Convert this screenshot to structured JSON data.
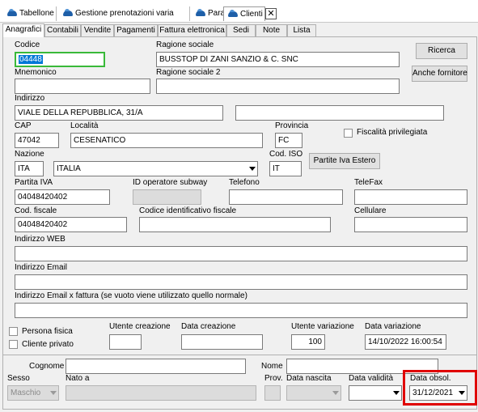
{
  "document_tabs": [
    {
      "label": "Tabellone",
      "icon": "table-icon"
    },
    {
      "label": "Gestione prenotazioni varia",
      "icon": "car-icon"
    },
    {
      "label": "Parametri",
      "icon": "car-icon"
    },
    {
      "label": "Clienti",
      "icon": "car-icon"
    }
  ],
  "close_label": "✕",
  "page_tabs": [
    "Anagrafici",
    "Contabili",
    "Vendite",
    "Pagamenti",
    "Fattura elettronica",
    "Sedi",
    "Note",
    "Lista"
  ],
  "form": {
    "codice_label": "Codice",
    "codice_value": "04448",
    "ragione_sociale_label": "Ragione sociale",
    "ragione_sociale_value": "BUSSTOP DI ZANI SANZIO & C. SNC",
    "ricerca_button": "Ricerca",
    "mnemonico_label": "Mnemonico",
    "mnemonico_value": "",
    "ragione_sociale2_label": "Ragione sociale 2",
    "ragione_sociale2_value": "",
    "anche_fornitore_button": "Anche fornitore",
    "indirizzo_label": "Indirizzo",
    "indirizzo_value": "VIALE DELLA REPUBBLICA, 31/A",
    "indirizzo2_value": "",
    "cap_label": "CAP",
    "cap_value": "47042",
    "localita_label": "Località",
    "localita_value": "CESENATICO",
    "provincia_label": "Provincia",
    "provincia_value": "FC",
    "fiscalita_label": "Fiscalità privilegiata",
    "nazione_label": "Nazione",
    "nazione_code": "ITA",
    "nazione_name": "ITALIA",
    "cod_iso_label": "Cod. ISO",
    "cod_iso_value": "IT",
    "partite_iva_estero_button": "Partite Iva Estero",
    "partita_iva_label": "Partita IVA",
    "partita_iva_value": "04048420402",
    "id_operatore_label": "ID operatore subway",
    "telefono_label": "Telefono",
    "telefax_label": "TeleFax",
    "cod_fiscale_label": "Cod. fiscale",
    "cod_fiscale_value": "04048420402",
    "codice_id_fiscale_label": "Codice identificativo fiscale",
    "cellulare_label": "Cellulare",
    "web_label": "Indirizzo WEB",
    "email_label": "Indirizzo Email",
    "email_fattura_label": "Indirizzo Email x fattura (se vuoto viene utilizzato quello normale)",
    "persona_fisica_label": "Persona fisica",
    "cliente_privato_label": "Cliente privato",
    "utente_creazione_label": "Utente creazione",
    "data_creazione_label": "Data creazione",
    "utente_variazione_label": "Utente variazione",
    "utente_variazione_value": "100",
    "data_variazione_label": "Data variazione",
    "data_variazione_value": "14/10/2022 16:00:54"
  },
  "person": {
    "cognome_label": "Cognome",
    "nome_label": "Nome",
    "sesso_label": "Sesso",
    "sesso_value": "Maschio",
    "nato_a_label": "Nato a",
    "prov_label": "Prov.",
    "data_nascita_label": "Data nascita",
    "data_validita_label": "Data validità",
    "data_obsol_label": "Data obsol.",
    "data_obsol_value": "31/12/2021"
  },
  "colors": {
    "highlight": "#e00000",
    "focus_border": "#39b939",
    "selection": "#0078d7"
  }
}
